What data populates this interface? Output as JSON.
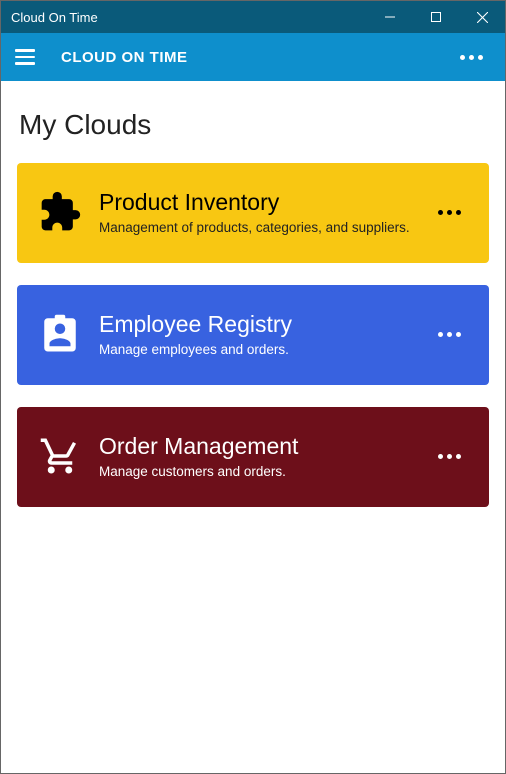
{
  "window": {
    "title": "Cloud On Time"
  },
  "appbar": {
    "title": "CLOUD ON TIME"
  },
  "page": {
    "heading": "My Clouds"
  },
  "cards": [
    {
      "title": "Product Inventory",
      "desc": "Management of products, categories, and suppliers.",
      "icon": "puzzle-icon",
      "style": "yellow"
    },
    {
      "title": "Employee Registry",
      "desc": "Manage employees and orders.",
      "icon": "badge-icon",
      "style": "blue"
    },
    {
      "title": "Order Management",
      "desc": "Manage customers and orders.",
      "icon": "cart-icon",
      "style": "red"
    }
  ]
}
